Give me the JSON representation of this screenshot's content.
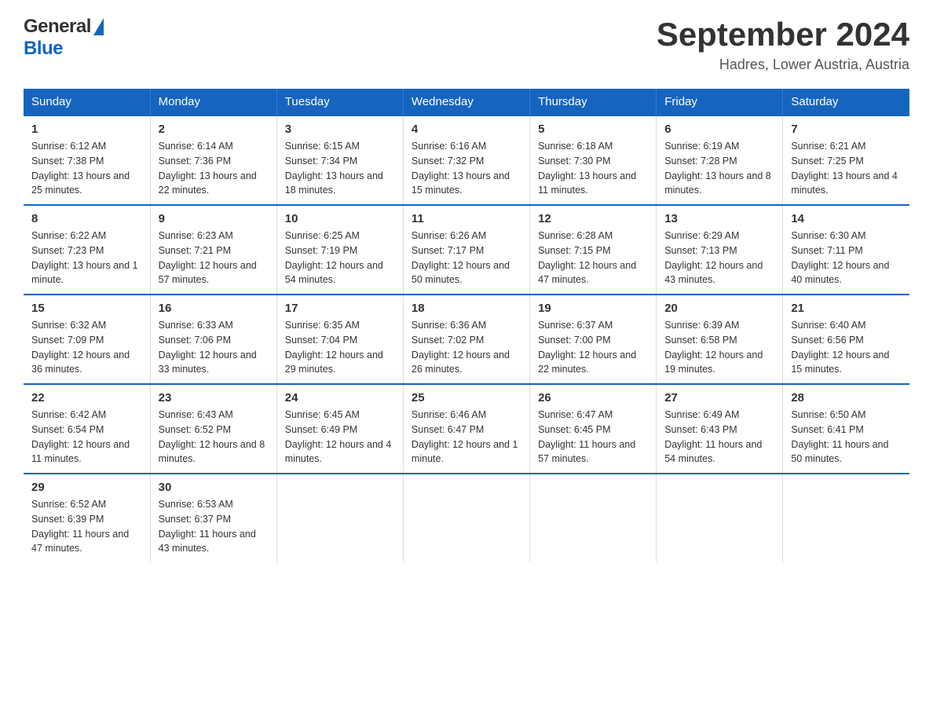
{
  "header": {
    "logo_general": "General",
    "logo_blue": "Blue",
    "title": "September 2024",
    "location": "Hadres, Lower Austria, Austria"
  },
  "calendar": {
    "days_of_week": [
      "Sunday",
      "Monday",
      "Tuesday",
      "Wednesday",
      "Thursday",
      "Friday",
      "Saturday"
    ],
    "weeks": [
      [
        {
          "day": "1",
          "sunrise": "6:12 AM",
          "sunset": "7:38 PM",
          "daylight": "13 hours and 25 minutes."
        },
        {
          "day": "2",
          "sunrise": "6:14 AM",
          "sunset": "7:36 PM",
          "daylight": "13 hours and 22 minutes."
        },
        {
          "day": "3",
          "sunrise": "6:15 AM",
          "sunset": "7:34 PM",
          "daylight": "13 hours and 18 minutes."
        },
        {
          "day": "4",
          "sunrise": "6:16 AM",
          "sunset": "7:32 PM",
          "daylight": "13 hours and 15 minutes."
        },
        {
          "day": "5",
          "sunrise": "6:18 AM",
          "sunset": "7:30 PM",
          "daylight": "13 hours and 11 minutes."
        },
        {
          "day": "6",
          "sunrise": "6:19 AM",
          "sunset": "7:28 PM",
          "daylight": "13 hours and 8 minutes."
        },
        {
          "day": "7",
          "sunrise": "6:21 AM",
          "sunset": "7:25 PM",
          "daylight": "13 hours and 4 minutes."
        }
      ],
      [
        {
          "day": "8",
          "sunrise": "6:22 AM",
          "sunset": "7:23 PM",
          "daylight": "13 hours and 1 minute."
        },
        {
          "day": "9",
          "sunrise": "6:23 AM",
          "sunset": "7:21 PM",
          "daylight": "12 hours and 57 minutes."
        },
        {
          "day": "10",
          "sunrise": "6:25 AM",
          "sunset": "7:19 PM",
          "daylight": "12 hours and 54 minutes."
        },
        {
          "day": "11",
          "sunrise": "6:26 AM",
          "sunset": "7:17 PM",
          "daylight": "12 hours and 50 minutes."
        },
        {
          "day": "12",
          "sunrise": "6:28 AM",
          "sunset": "7:15 PM",
          "daylight": "12 hours and 47 minutes."
        },
        {
          "day": "13",
          "sunrise": "6:29 AM",
          "sunset": "7:13 PM",
          "daylight": "12 hours and 43 minutes."
        },
        {
          "day": "14",
          "sunrise": "6:30 AM",
          "sunset": "7:11 PM",
          "daylight": "12 hours and 40 minutes."
        }
      ],
      [
        {
          "day": "15",
          "sunrise": "6:32 AM",
          "sunset": "7:09 PM",
          "daylight": "12 hours and 36 minutes."
        },
        {
          "day": "16",
          "sunrise": "6:33 AM",
          "sunset": "7:06 PM",
          "daylight": "12 hours and 33 minutes."
        },
        {
          "day": "17",
          "sunrise": "6:35 AM",
          "sunset": "7:04 PM",
          "daylight": "12 hours and 29 minutes."
        },
        {
          "day": "18",
          "sunrise": "6:36 AM",
          "sunset": "7:02 PM",
          "daylight": "12 hours and 26 minutes."
        },
        {
          "day": "19",
          "sunrise": "6:37 AM",
          "sunset": "7:00 PM",
          "daylight": "12 hours and 22 minutes."
        },
        {
          "day": "20",
          "sunrise": "6:39 AM",
          "sunset": "6:58 PM",
          "daylight": "12 hours and 19 minutes."
        },
        {
          "day": "21",
          "sunrise": "6:40 AM",
          "sunset": "6:56 PM",
          "daylight": "12 hours and 15 minutes."
        }
      ],
      [
        {
          "day": "22",
          "sunrise": "6:42 AM",
          "sunset": "6:54 PM",
          "daylight": "12 hours and 11 minutes."
        },
        {
          "day": "23",
          "sunrise": "6:43 AM",
          "sunset": "6:52 PM",
          "daylight": "12 hours and 8 minutes."
        },
        {
          "day": "24",
          "sunrise": "6:45 AM",
          "sunset": "6:49 PM",
          "daylight": "12 hours and 4 minutes."
        },
        {
          "day": "25",
          "sunrise": "6:46 AM",
          "sunset": "6:47 PM",
          "daylight": "12 hours and 1 minute."
        },
        {
          "day": "26",
          "sunrise": "6:47 AM",
          "sunset": "6:45 PM",
          "daylight": "11 hours and 57 minutes."
        },
        {
          "day": "27",
          "sunrise": "6:49 AM",
          "sunset": "6:43 PM",
          "daylight": "11 hours and 54 minutes."
        },
        {
          "day": "28",
          "sunrise": "6:50 AM",
          "sunset": "6:41 PM",
          "daylight": "11 hours and 50 minutes."
        }
      ],
      [
        {
          "day": "29",
          "sunrise": "6:52 AM",
          "sunset": "6:39 PM",
          "daylight": "11 hours and 47 minutes."
        },
        {
          "day": "30",
          "sunrise": "6:53 AM",
          "sunset": "6:37 PM",
          "daylight": "11 hours and 43 minutes."
        },
        {
          "day": "",
          "sunrise": "",
          "sunset": "",
          "daylight": ""
        },
        {
          "day": "",
          "sunrise": "",
          "sunset": "",
          "daylight": ""
        },
        {
          "day": "",
          "sunrise": "",
          "sunset": "",
          "daylight": ""
        },
        {
          "day": "",
          "sunrise": "",
          "sunset": "",
          "daylight": ""
        },
        {
          "day": "",
          "sunrise": "",
          "sunset": "",
          "daylight": ""
        }
      ]
    ],
    "labels": {
      "sunrise": "Sunrise:",
      "sunset": "Sunset:",
      "daylight": "Daylight:"
    }
  }
}
